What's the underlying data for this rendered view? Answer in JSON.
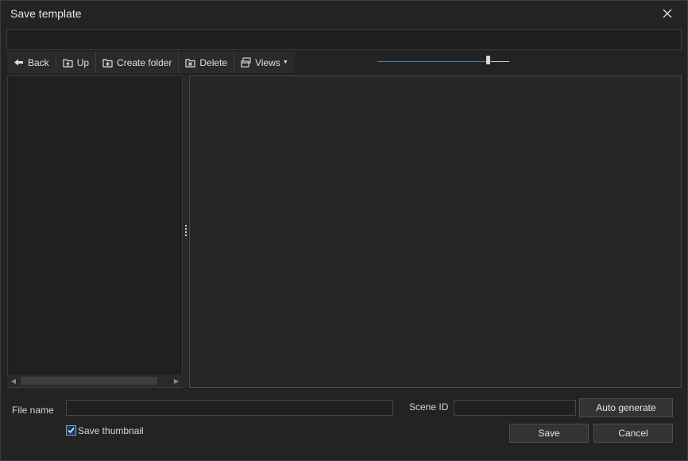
{
  "dialog": {
    "title": "Save template"
  },
  "toolbar": {
    "back_label": "Back",
    "up_label": "Up",
    "create_folder_label": "Create folder",
    "delete_label": "Delete",
    "views_label": "Views"
  },
  "zoom": {
    "level_fraction": 0.85
  },
  "form": {
    "file_name_label": "File name",
    "file_name_value": "",
    "scene_id_label": "Scene ID",
    "scene_id_value": "",
    "auto_generate_label": "Auto generate",
    "save_thumbnail_label": "Save thumbnail",
    "save_thumbnail_checked": true,
    "save_label": "Save",
    "cancel_label": "Cancel"
  },
  "colors": {
    "background": "#232323",
    "accent": "#3a7bd5"
  },
  "icons": {
    "close": "close-icon",
    "back": "arrow-left-icon",
    "up": "folder-up-icon",
    "create_folder": "folder-plus-icon",
    "delete": "folder-delete-icon",
    "views": "views-icon"
  }
}
